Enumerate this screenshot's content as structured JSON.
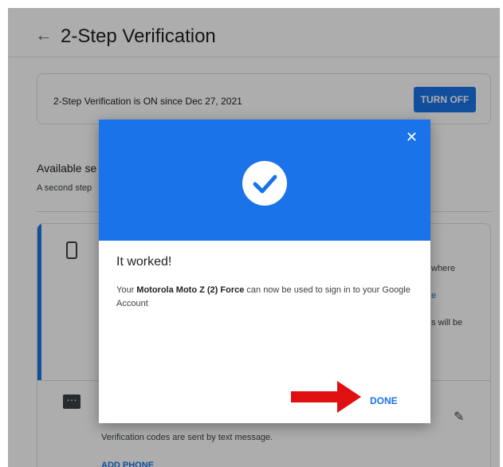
{
  "header": {
    "back_icon": "arrow-back-icon",
    "title": "2-Step Verification"
  },
  "status_card": {
    "text": "2-Step Verification is ON since Dec 27, 2021",
    "turn_off_label": "TURN OFF"
  },
  "available": {
    "title_fragment": "Available se",
    "subtitle_fragment": "A second step"
  },
  "options": {
    "fragment_1": "where",
    "fragment_2": "e",
    "fragment_3": "s will be",
    "sms_description": "Verification codes are sent by text message.",
    "add_phone_label": "ADD PHONE"
  },
  "dialog": {
    "title": "It worked!",
    "body_prefix": "Your ",
    "device_name": "Motorola Moto Z (2) Force",
    "body_suffix": " can now be used to sign in to your Google Account",
    "done_label": "DONE"
  },
  "colors": {
    "accent": "#1a73e8",
    "annotation_arrow": "#e01010"
  }
}
